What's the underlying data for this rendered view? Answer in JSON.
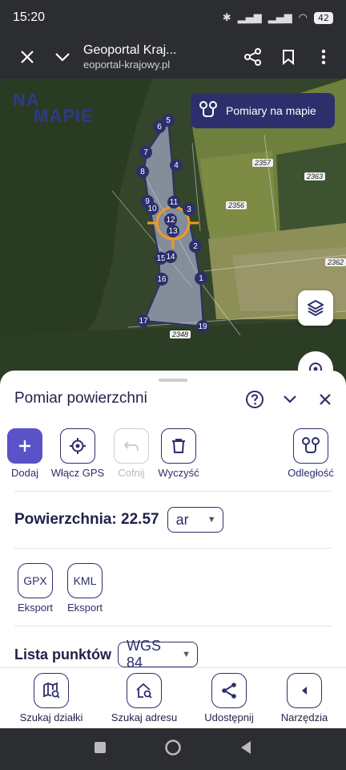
{
  "status_bar": {
    "time": "15:20",
    "battery": "42"
  },
  "browser": {
    "title": "Geoportal Kraj...",
    "url": "eoportal-krajowy.pl"
  },
  "map": {
    "logo_top": "NA",
    "logo_bottom": "MAPIE",
    "measure_button": "Pomiary na mapie",
    "plot_labels": [
      "2357",
      "2363",
      "2356",
      "2362",
      "2348"
    ],
    "points": [
      "5",
      "6",
      "7",
      "4",
      "8",
      "9",
      "10",
      "11",
      "3",
      "12",
      "13",
      "2",
      "15",
      "14",
      "16",
      "1",
      "17",
      "19"
    ],
    "center_label": "2"
  },
  "panel": {
    "title": "Pomiar powierzchni",
    "tools": {
      "add": "Dodaj",
      "gps": "Włącz GPS",
      "undo": "Cofnij",
      "clear": "Wyczyść",
      "distance": "Odległość"
    },
    "area_label": "Powierzchnia: 22.57",
    "unit": "ar",
    "exports": {
      "gpx_icon": "GPX",
      "gpx_label": "Eksport",
      "kml_icon": "KML",
      "kml_label": "Eksport"
    },
    "points_list_label": "Lista punktów",
    "crs": "WGS 84"
  },
  "bottom_nav": {
    "parcel": "Szukaj działki",
    "address": "Szukaj adresu",
    "share": "Udostępnij",
    "tools": "Narzędzia"
  },
  "colors": {
    "accent": "#2c2f6b",
    "add_button": "#5a52c9",
    "target": "#f39a1e",
    "polygon": "#b9bfe6"
  }
}
